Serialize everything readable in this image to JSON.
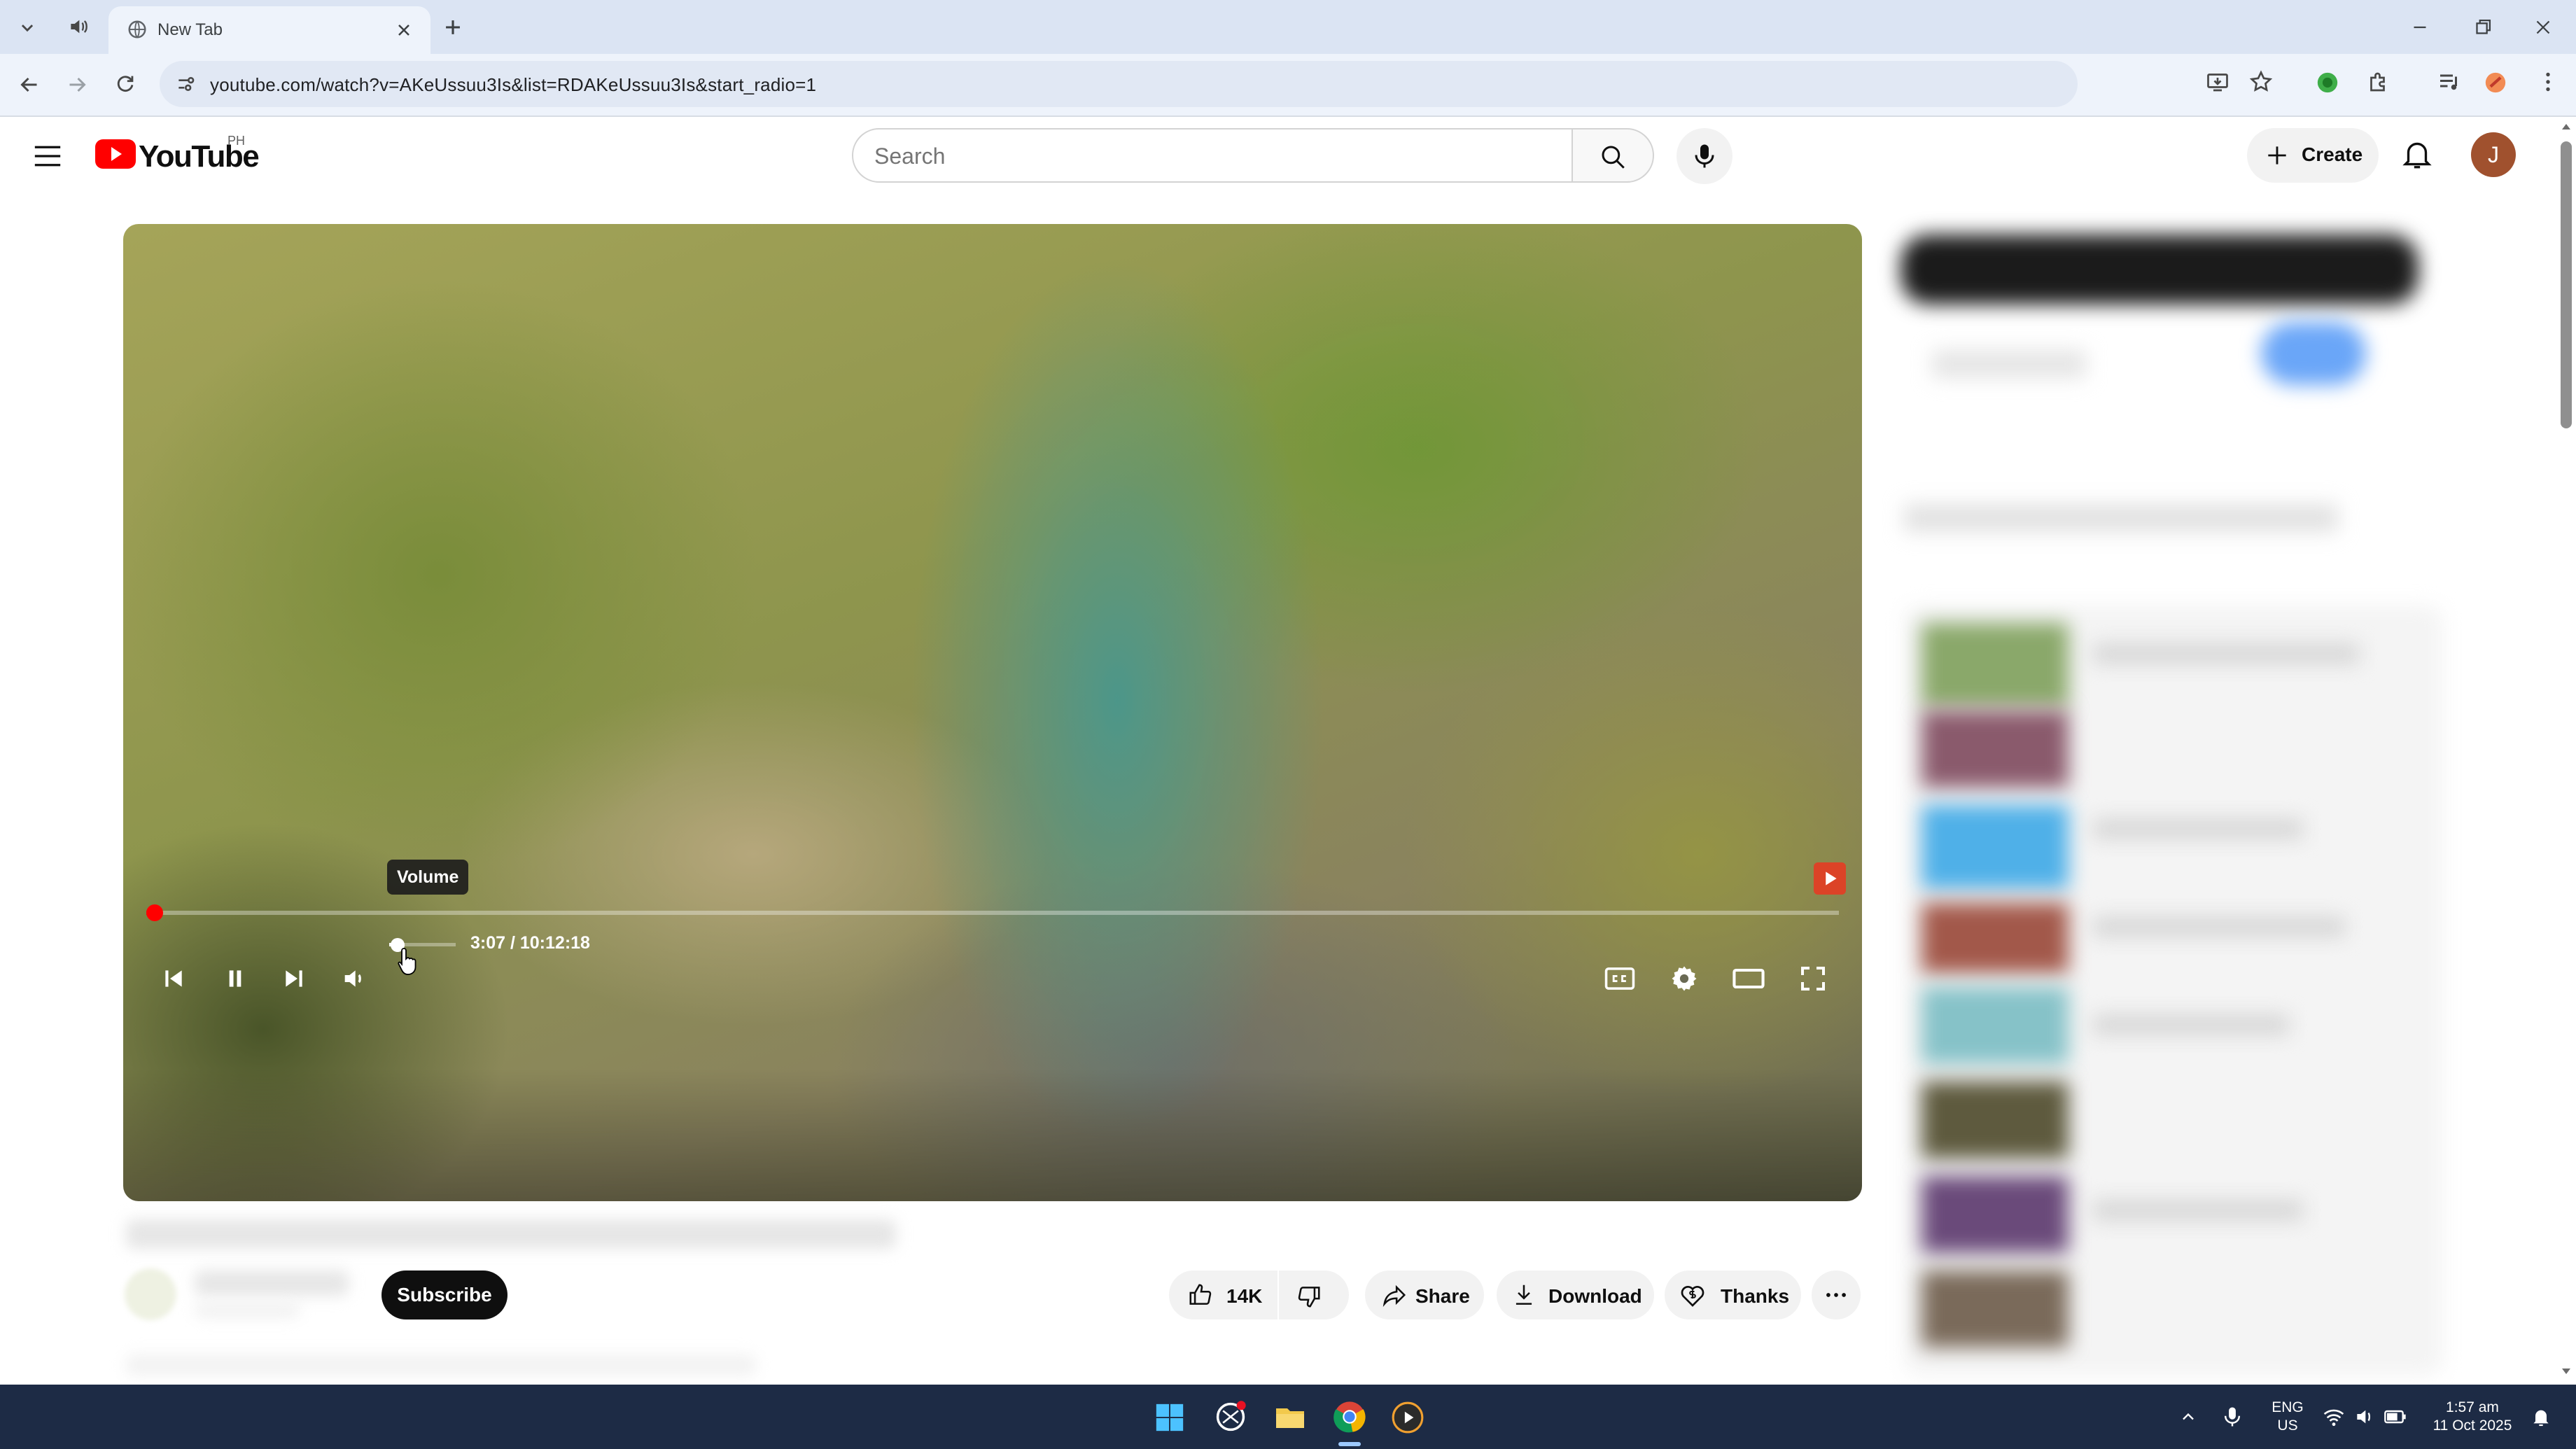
{
  "browser": {
    "tab_title": "New Tab",
    "url": "youtube.com/watch?v=AKeUssuu3Is&list=RDAKeUssuu3Is&start_radio=1",
    "icons": [
      "tab-search-icon",
      "speaker-icon",
      "globe-icon",
      "close-icon",
      "new-tab-icon",
      "back-icon",
      "forward-icon",
      "reload-icon",
      "site-info-icon",
      "install-icon",
      "bookmark-star-icon",
      "extension-icon",
      "puzzle-icon",
      "media-icon",
      "profile-extension-icon",
      "menu-dots-icon"
    ]
  },
  "youtube": {
    "logo_text": "YouTube",
    "region": "PH",
    "search_placeholder": "Search",
    "create_label": "Create",
    "avatar_letter": "J",
    "brand_color": "#ff0000"
  },
  "player": {
    "tooltip": "Volume",
    "time": "3:07 / 10:12:18",
    "progress_fraction": 0.005,
    "volume_fraction": 0.1,
    "state": "playing"
  },
  "actions": {
    "subscribe_label": "Subscribe",
    "likes": "14K",
    "share_label": "Share",
    "download_label": "Download",
    "thanks_label": "Thanks"
  },
  "taskbar": {
    "lang_line1": "ENG",
    "lang_line2": "US",
    "clock_time": "1:57 am",
    "clock_date": "11 Oct 2025"
  }
}
